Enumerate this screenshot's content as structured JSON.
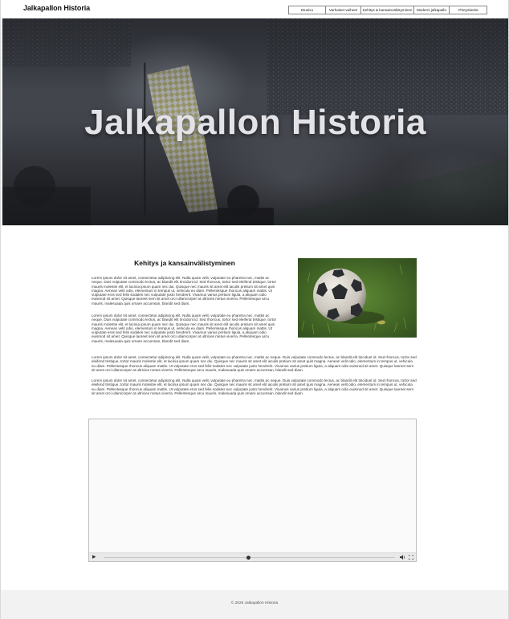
{
  "header": {
    "site_title": "Jalkapallon Historia",
    "nav": [
      "Etusivu",
      "Varhaiset vaiheet",
      "Kehitys & kansainvälistyminen",
      "Moderni jalkapallo",
      "Yhteystiedot"
    ]
  },
  "hero": {
    "title": "Jalkapallon Historia"
  },
  "article": {
    "heading": "Kehitys ja kansainvälistyminen",
    "paragraphs": [
      "Lorem ipsum dolor sit amet, consectetur adipiscing elit. Nulla quam velit, vulputate eu pharetra nec, mattis ac neque. Duis vulputate commodo lectus, ac blandit elit tincidunt id. Sed rhoncus, tortor sed eleifend tristique, tortor mauris molestie elit, et lacinia ipsum quam nec dui. Quisque nec mauris sit amet elit iaculis pretium sit amet quis magna. Aenean velit odio, elementum in tempus ut, vehicula eu diam. Pellentesque rhoncus aliquam mattis. Ut vulputate eros sed felis sodales nec vulputate justo hendrerit. Vivamus varius pretium ligula, a aliquam odio euismod sit amet. Quisque laoreet sem sit amet orci ullamcorper at ultricies metus viverra. Pellentesque arcu mauris, malesuada quis ornare accumsan, blandit sed diam.",
      "Lorem ipsum dolor sit amet, consectetur adipiscing elit. Nulla quam velit, vulputate eu pharetra nec, mattis ac neque. Duis vulputate commodo lectus, ac blandit elit tincidunt id. Sed rhoncus, tortor sed eleifend tristique, tortor mauris molestie elit, et lacinia ipsum quam nec dui. Quisque nec mauris sit amet elit iaculis pretium sit amet quis magna. Aenean velit odio, elementum in tempus ut, vehicula eu diam. Pellentesque rhoncus aliquam mattis. Ut vulputate eros sed felis sodales nec vulputate justo hendrerit. Vivamus varius pretium ligula, a aliquam odio euismod sit amet. Quisque laoreet sem sit amet orci ullamcorper at ultricies metus viverra. Pellentesque arcu mauris, malesuada quis ornare accumsan, blandit sed diam.",
      "Lorem ipsum dolor sit amet, consectetur adipiscing elit. Nulla quam velit, vulputate eu pharetra nec, mattis ac neque. Duis vulputate commodo lectus, ac blandit elit tincidunt id. Sed rhoncus, tortor sed eleifend tristique, tortor mauris molestie elit, et lacinia ipsum quam nec dui. Quisque nec mauris sit amet elit iaculis pretium sit amet quis magna. Aenean velit odio, elementum in tempus ut, vehicula eu diam. Pellentesque rhoncus aliquam mattis. Ut vulputate eros sed felis sodales nec vulputate justo hendrerit. Vivamus varius pretium ligula, a aliquam odio euismod sit amet. Quisque laoreet sem sit amet orci ullamcorper at ultricies metus viverra. Pellentesque arcu mauris, malesuada quis ornare accumsan, blandit sed diam.",
      "Lorem ipsum dolor sit amet, consectetur adipiscing elit. Nulla quam velit, vulputate eu pharetra nec, mattis ac neque. Duis vulputate commodo lectus, ac blandit elit tincidunt id. Sed rhoncus, tortor sed eleifend tristique, tortor mauris molestie elit, et lacinia ipsum quam nec dui. Quisque nec mauris sit amet elit iaculis pretium sit amet quis magna. Aenean velit odio, elementum in tempus ut, vehicula eu diam. Pellentesque rhoncus aliquam mattis. Ut vulputate eros sed felis sodales nec vulputate justo hendrerit. Vivamus varius pretium ligula, a aliquam odio euismod sit amet. Quisque laoreet sem sit amet orci ullamcorper at ultricies metus viverra. Pellentesque arcu mauris, malesuada quis ornare accumsan, blandit sed diam."
    ]
  },
  "video": {
    "play_icon": "play-icon",
    "volume_icon": "volume-icon",
    "fullscreen_icon": "fullscreen-icon"
  },
  "footer": {
    "copyright": "© 2025 Jalkapallon Historia"
  },
  "colors": {
    "hero_overlay": "#3e4149",
    "hero_title": "#e3e3e7",
    "footer_bg": "#f2f2f2",
    "grass": "#3c5a23"
  }
}
